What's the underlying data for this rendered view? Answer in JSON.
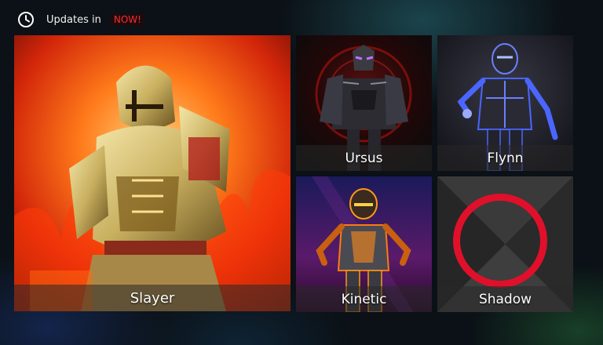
{
  "header": {
    "icon": "clock-icon",
    "updates_label": "Updates in",
    "updates_value": "NOW!",
    "accent_color": "#ff2a2a"
  },
  "characters": [
    {
      "name": "Slayer",
      "theme": "#ff5a10"
    },
    {
      "name": "Ursus",
      "theme": "#cc2020"
    },
    {
      "name": "Flynn",
      "theme": "#4a66ff"
    },
    {
      "name": "Kinetic",
      "theme": "#ff9a10"
    },
    {
      "name": "Shadow",
      "theme": "#e0102a"
    }
  ]
}
